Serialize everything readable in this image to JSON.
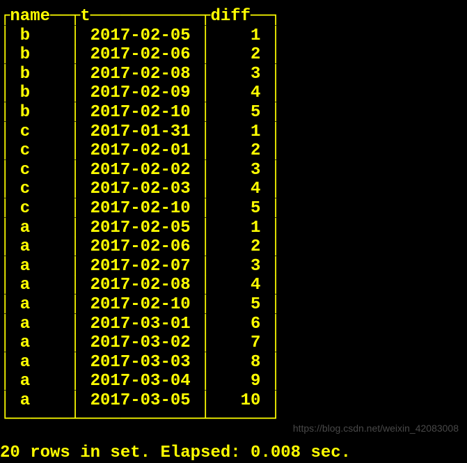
{
  "table": {
    "columns": [
      "name",
      "t",
      "diff"
    ],
    "rows": [
      {
        "name": "b",
        "t": "2017-02-05",
        "diff": "1"
      },
      {
        "name": "b",
        "t": "2017-02-06",
        "diff": "2"
      },
      {
        "name": "b",
        "t": "2017-02-08",
        "diff": "3"
      },
      {
        "name": "b",
        "t": "2017-02-09",
        "diff": "4"
      },
      {
        "name": "b",
        "t": "2017-02-10",
        "diff": "5"
      },
      {
        "name": "c",
        "t": "2017-01-31",
        "diff": "1"
      },
      {
        "name": "c",
        "t": "2017-02-01",
        "diff": "2"
      },
      {
        "name": "c",
        "t": "2017-02-02",
        "diff": "3"
      },
      {
        "name": "c",
        "t": "2017-02-03",
        "diff": "4"
      },
      {
        "name": "c",
        "t": "2017-02-10",
        "diff": "5"
      },
      {
        "name": "a",
        "t": "2017-02-05",
        "diff": "1"
      },
      {
        "name": "a",
        "t": "2017-02-06",
        "diff": "2"
      },
      {
        "name": "a",
        "t": "2017-02-07",
        "diff": "3"
      },
      {
        "name": "a",
        "t": "2017-02-08",
        "diff": "4"
      },
      {
        "name": "a",
        "t": "2017-02-10",
        "diff": "5"
      },
      {
        "name": "a",
        "t": "2017-03-01",
        "diff": "6"
      },
      {
        "name": "a",
        "t": "2017-03-02",
        "diff": "7"
      },
      {
        "name": "a",
        "t": "2017-03-03",
        "diff": "8"
      },
      {
        "name": "a",
        "t": "2017-03-04",
        "diff": "9"
      },
      {
        "name": "a",
        "t": "2017-03-05",
        "diff": "10"
      }
    ]
  },
  "status": "20 rows in set. Elapsed: 0.008 sec.",
  "chart_data": {
    "type": "table",
    "columns": [
      "name",
      "t",
      "diff"
    ],
    "rows": [
      [
        "b",
        "2017-02-05",
        1
      ],
      [
        "b",
        "2017-02-06",
        2
      ],
      [
        "b",
        "2017-02-08",
        3
      ],
      [
        "b",
        "2017-02-09",
        4
      ],
      [
        "b",
        "2017-02-10",
        5
      ],
      [
        "c",
        "2017-01-31",
        1
      ],
      [
        "c",
        "2017-02-01",
        2
      ],
      [
        "c",
        "2017-02-02",
        3
      ],
      [
        "c",
        "2017-02-03",
        4
      ],
      [
        "c",
        "2017-02-10",
        5
      ],
      [
        "a",
        "2017-02-05",
        1
      ],
      [
        "a",
        "2017-02-06",
        2
      ],
      [
        "a",
        "2017-02-07",
        3
      ],
      [
        "a",
        "2017-02-08",
        4
      ],
      [
        "a",
        "2017-02-10",
        5
      ],
      [
        "a",
        "2017-03-01",
        6
      ],
      [
        "a",
        "2017-03-02",
        7
      ],
      [
        "a",
        "2017-03-03",
        8
      ],
      [
        "a",
        "2017-03-04",
        9
      ],
      [
        "a",
        "2017-03-05",
        10
      ]
    ]
  },
  "watermark": "https://blog.csdn.net/weixin_42083008",
  "box": {
    "tl": "┌",
    "tm": "┬",
    "tr": "┐",
    "bl": "└",
    "bm": "┴",
    "br": "┘",
    "h": "─",
    "v": "│"
  },
  "widths": {
    "name": 6,
    "t": 12,
    "diff": 6
  }
}
